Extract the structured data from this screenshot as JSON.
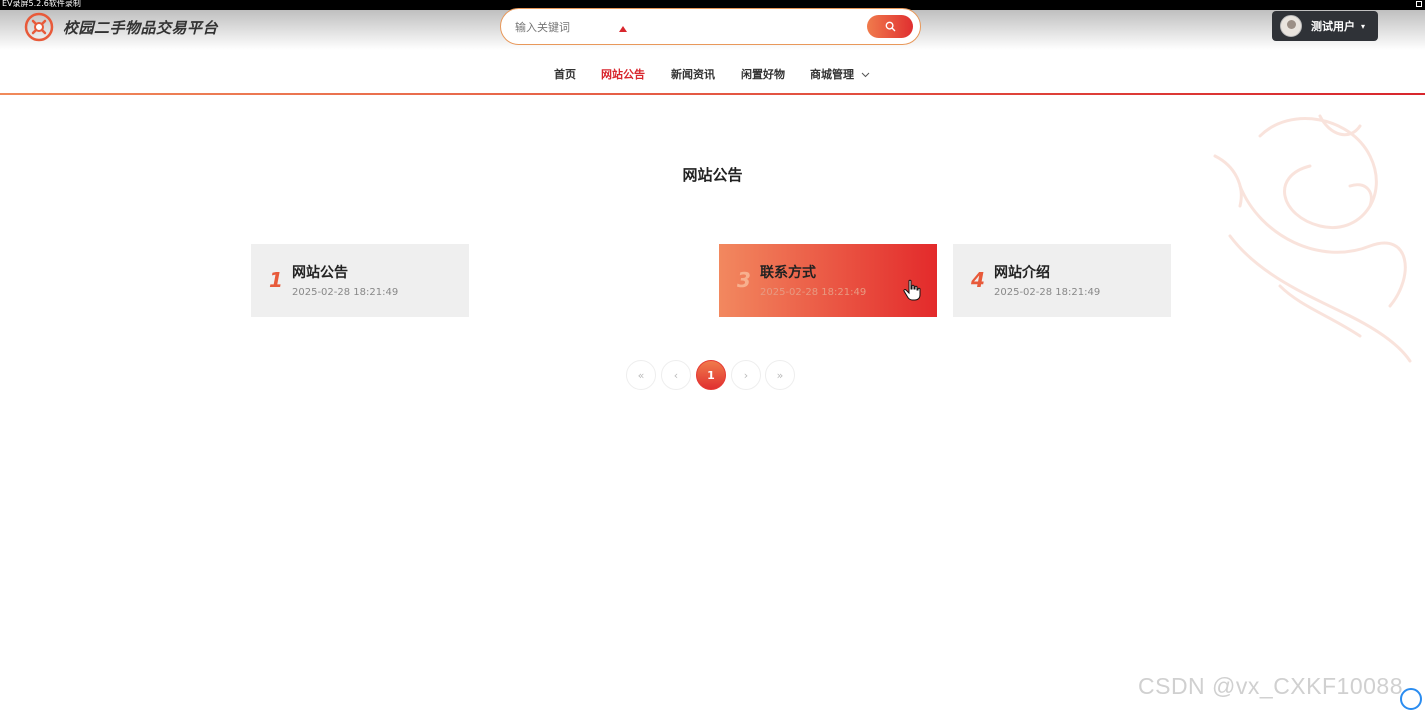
{
  "recorder": {
    "label": "EV录屏5.2.6软件录制"
  },
  "header": {
    "logo_text": "校园二手物品交易平台",
    "search_placeholder": "输入关键词",
    "user_name": "测试用户",
    "user_caret": "▾"
  },
  "nav": {
    "items": [
      {
        "label": "首页"
      },
      {
        "label": "网站公告",
        "active": true
      },
      {
        "label": "新闻资讯"
      },
      {
        "label": "闲置好物"
      },
      {
        "label": "商城管理"
      }
    ],
    "dropdown_icon": "chevron-down-icon"
  },
  "main": {
    "title": "网站公告",
    "cards": [
      {
        "num": "1",
        "title": "网站公告",
        "date": "2025-02-28 18:21:49"
      },
      {
        "num": "3",
        "title": "联系方式",
        "date": "2025-02-28 18:21:49"
      },
      {
        "num": "4",
        "title": "网站介绍",
        "date": "2025-02-28 18:21:49"
      }
    ]
  },
  "pagination": {
    "first": "«",
    "prev": "‹",
    "current": "1",
    "next": "›",
    "last": "»"
  },
  "watermark": "CSDN @vx_CXKF10088",
  "colors": {
    "accent": "#d8262d",
    "accent_light": "#f07b4c",
    "search_border": "#e8985a",
    "user_btn_bg": "#2f3237"
  }
}
